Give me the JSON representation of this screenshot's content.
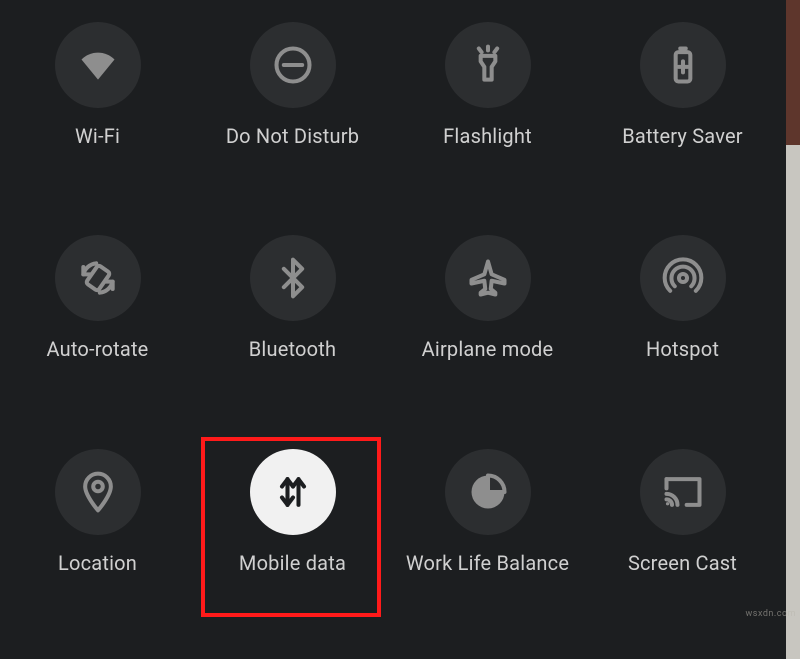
{
  "tiles": [
    {
      "id": "wifi",
      "label": "Wi-Fi",
      "active": false
    },
    {
      "id": "dnd",
      "label": "Do Not Disturb",
      "active": false
    },
    {
      "id": "flashlight",
      "label": "Flashlight",
      "active": false
    },
    {
      "id": "battery-saver",
      "label": "Battery Saver",
      "active": false
    },
    {
      "id": "auto-rotate",
      "label": "Auto-rotate",
      "active": false
    },
    {
      "id": "bluetooth",
      "label": "Bluetooth",
      "active": false
    },
    {
      "id": "airplane",
      "label": "Airplane mode",
      "active": false
    },
    {
      "id": "hotspot",
      "label": "Hotspot",
      "active": false
    },
    {
      "id": "location",
      "label": "Location",
      "active": false
    },
    {
      "id": "mobile-data",
      "label": "Mobile data",
      "active": true,
      "highlighted": true
    },
    {
      "id": "work-life",
      "label": "Work Life Balance",
      "active": false
    },
    {
      "id": "screen-cast",
      "label": "Screen Cast",
      "active": false
    }
  ],
  "watermark": "wsxdn.com",
  "highlight_color": "#ff1a1a"
}
